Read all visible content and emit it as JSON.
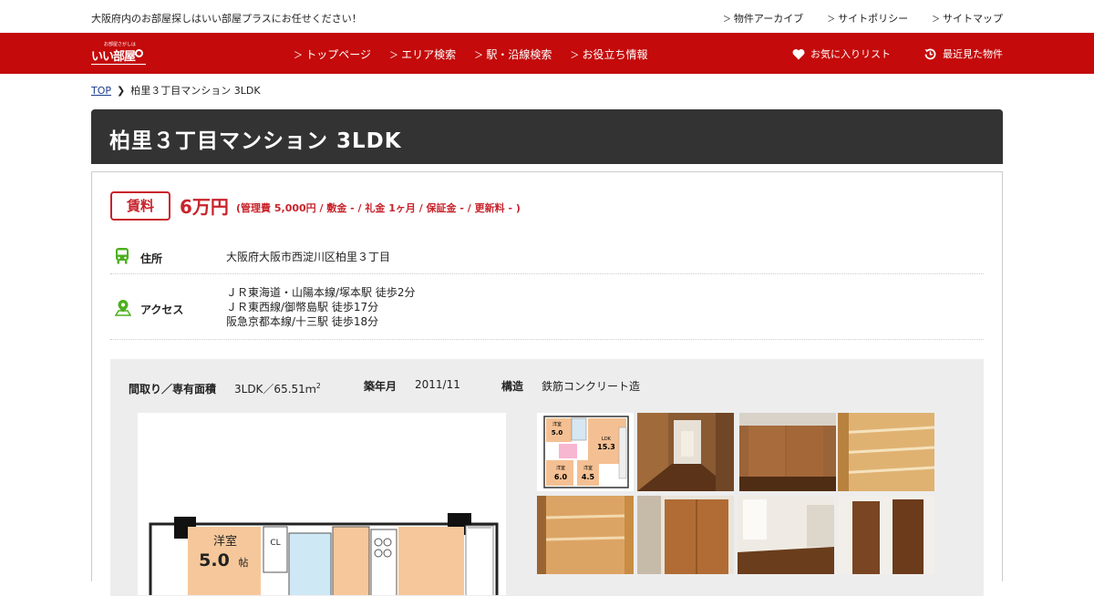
{
  "topbar": {
    "tagline": "大阪府内のお部屋探しはいい部屋プラスにお任せください！",
    "links": [
      "物件アーカイブ",
      "サイトポリシー",
      "サイトマップ"
    ]
  },
  "header": {
    "logo_small": "お部屋さがしは",
    "logo_main": "いい部屋",
    "nav": [
      "トップページ",
      "エリア検索",
      "駅・沿線検索",
      "お役立ち情報"
    ],
    "favorites": "お気に入りリスト",
    "recent": "最近見た物件"
  },
  "breadcrumb": {
    "home": "TOP",
    "separator": "❯",
    "current": "柏里３丁目マンション 3LDK"
  },
  "title": "柏里３丁目マンション  3LDK",
  "rent": {
    "badge": "賃料",
    "price": "6万円",
    "note": "(管理費 5,000円 / 敷金 - / 礼金 1ヶ月 / 保証金 - / 更新料 - )"
  },
  "details": {
    "address_label": "住所",
    "address": "大阪府大阪市西淀川区柏里３丁目",
    "access_label": "アクセス",
    "access": [
      "ＪＲ東海道・山陽本線/塚本駅 徒歩2分",
      "ＪＲ東西線/御幣島駅 徒歩17分",
      "阪急京都本線/十三駅 徒歩18分"
    ]
  },
  "spec": {
    "layout_label": "間取り／専有面積",
    "layout_value": "3LDK／65.51ｍ",
    "layout_sup": "2",
    "built_label": "築年月",
    "built_value": "2011/11",
    "structure_label": "構造",
    "structure_value": "鉄筋コンクリート造"
  },
  "floorplan": {
    "room_label": "洋室",
    "room_size": "5.0",
    "room_unit": "帖",
    "cl": "CL"
  },
  "thumb_plan": {
    "r1": "洋室",
    "r1s": "5.0",
    "r2": "LDK",
    "r2s": "15.3",
    "r3": "洋室",
    "r3s": "6.0",
    "r4": "洋室",
    "r4s": "4.5"
  },
  "colors": {
    "brand_red": "#c40a0a",
    "accent_red": "#c8232c",
    "icon_green": "#4caf1f",
    "title_bg": "#333333"
  },
  "icons": {
    "bus": "bus-icon",
    "pin": "map-pin-icon",
    "heart": "heart-icon",
    "clock": "history-clock-icon"
  }
}
